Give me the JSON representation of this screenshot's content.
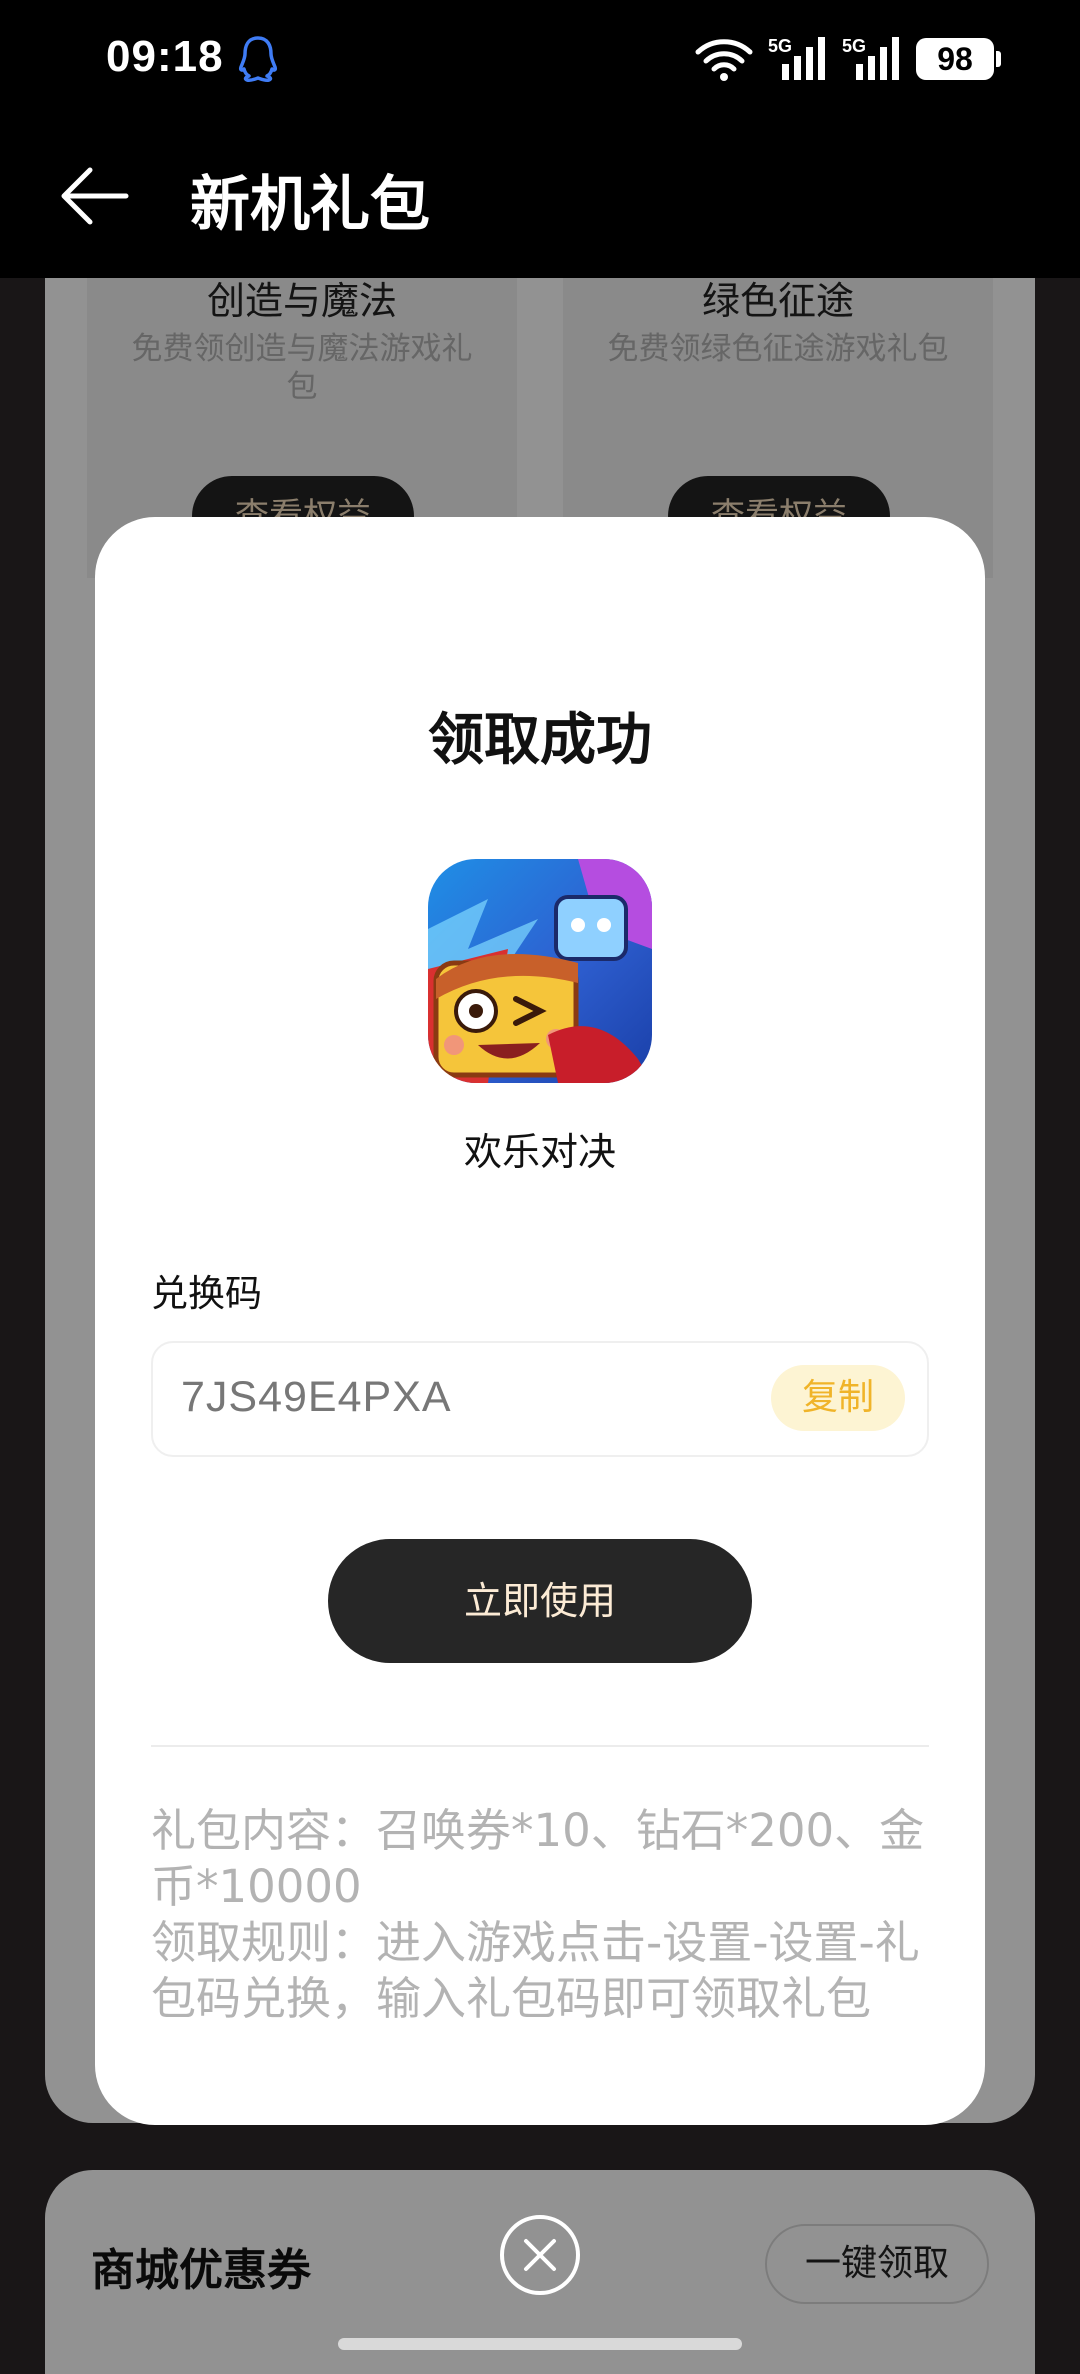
{
  "status_bar": {
    "time": "09:18",
    "signal_label": "5G",
    "battery": "98",
    "icons": [
      "qq-icon",
      "wifi-icon",
      "signal-icon",
      "signal-icon",
      "battery-icon"
    ]
  },
  "header": {
    "title": "新机礼包",
    "back_icon": "back-arrow-icon"
  },
  "background": {
    "gift_cards": [
      {
        "name": "创造与魔法",
        "desc": "免费领创造与魔法游戏礼包",
        "button": "查看权益"
      },
      {
        "name": "绿色征途",
        "desc": "免费领绿色征途游戏礼包",
        "button": "查看权益"
      }
    ],
    "coupon_section": {
      "title": "商城优惠券",
      "claim_all": "一键领取"
    }
  },
  "dialog": {
    "title": "领取成功",
    "game_name": "欢乐对决",
    "code_label": "兑换码",
    "code": "7JS49E4PXA",
    "copy_label": "复制",
    "use_label": "立即使用",
    "gift_content": "礼包内容：召唤券*10、钻石*200、金币*10000",
    "claim_rules": "领取规则：进入游戏点击-设置-设置-礼包码兑换，输入礼包码即可领取礼包"
  },
  "colors": {
    "copy_accent": "#f0b429",
    "use_button_bg": "#262626",
    "view_button_text": "#e8d3b4"
  }
}
